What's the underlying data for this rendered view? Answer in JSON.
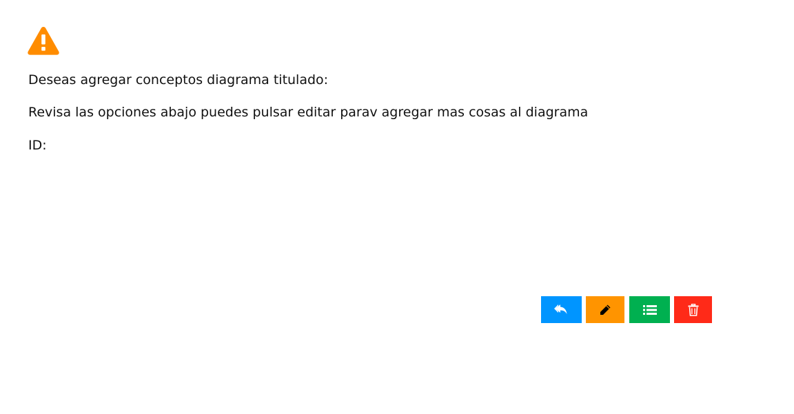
{
  "alert": {
    "icon": "warning-icon",
    "icon_color": "#FF8C00",
    "line1": "Deseas agregar conceptos diagrama titulado:",
    "line2": "Revisa las opciones abajo puedes pulsar editar parav agregar mas cosas al diagrama",
    "line3": "ID:"
  },
  "actions": [
    {
      "name": "reply",
      "icon": "reply-icon",
      "color": "#0095FF",
      "icon_color": "#FFFFFF"
    },
    {
      "name": "edit",
      "icon": "pencil-icon",
      "color": "#FF9400",
      "icon_color": "#000000"
    },
    {
      "name": "list",
      "icon": "list-icon",
      "color": "#00B050",
      "icon_color": "#FFFFFF"
    },
    {
      "name": "delete",
      "icon": "trash-icon",
      "color": "#FF2A18",
      "icon_color": "#FFFFFF"
    }
  ]
}
